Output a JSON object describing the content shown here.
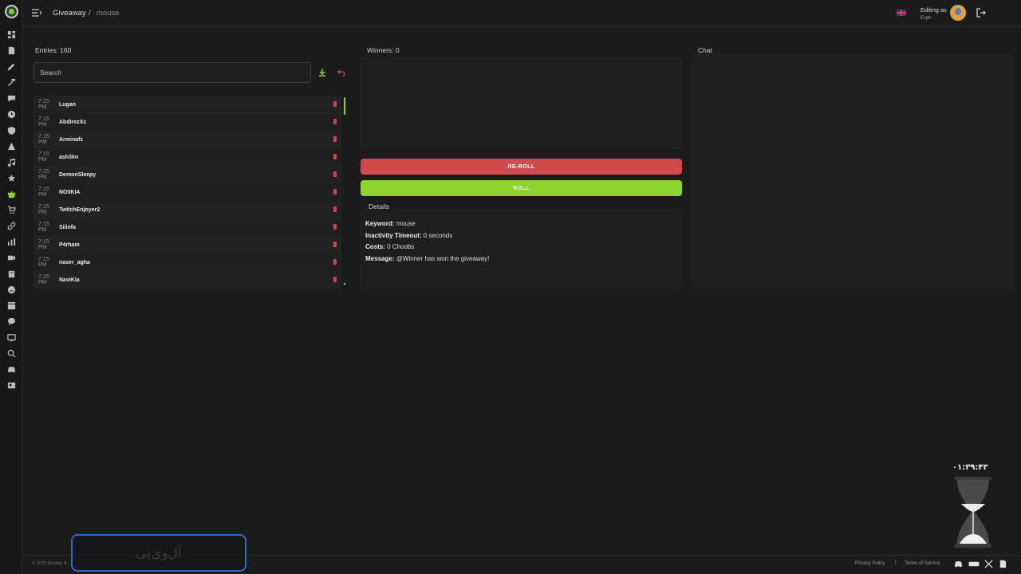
{
  "header": {
    "breadcrumb_section": "Giveaway",
    "breadcrumb_separator": "/",
    "breadcrumb_current": "mouse",
    "editing_label": "Editing as",
    "editing_user": "Erph"
  },
  "entries": {
    "title": "Entries: 160",
    "search_placeholder": "Search",
    "items": [
      {
        "time": "7:15 PM",
        "name": "Lugan"
      },
      {
        "time": "7:15 PM",
        "name": "AbdirezXc"
      },
      {
        "time": "7:15 PM",
        "name": "Arminafz"
      },
      {
        "time": "7:15 PM",
        "name": "ash3kn"
      },
      {
        "time": "7:15 PM",
        "name": "DemonSleepy"
      },
      {
        "time": "7:15 PM",
        "name": "NO0KIA"
      },
      {
        "time": "7:15 PM",
        "name": "TwitchEnjoyer2"
      },
      {
        "time": "7:15 PM",
        "name": "Siiinfa"
      },
      {
        "time": "7:15 PM",
        "name": "P4rham"
      },
      {
        "time": "7:15 PM",
        "name": "naser_agha"
      },
      {
        "time": "7:15 PM",
        "name": "NaviKia"
      }
    ]
  },
  "winners": {
    "title": "Winners: 0"
  },
  "actions": {
    "reroll_label": "RE-ROLL",
    "roll_label": "ROLL"
  },
  "details": {
    "title": "Details",
    "keyword_label": "Keyword:",
    "keyword_value": "mouse",
    "inactivity_label": "Inactivity Timeout:",
    "inactivity_value": "0 seconds",
    "costs_label": "Costs:",
    "costs_value": "0 Choobs",
    "message_label": "Message:",
    "message_value": "@Winner has won the giveaway!"
  },
  "chat": {
    "title": "Chat"
  },
  "footer": {
    "copyright": "© 2025 Kickbot. A",
    "privacy": "Privacy Policy",
    "separator": "|",
    "terms": "Terms of Service"
  },
  "overlay": {
    "timer": "۰۱:۳۹:۴۳",
    "watermark": "آل‌وی‌پی"
  },
  "colors": {
    "accent": "#8fd42e",
    "danger": "#cf4b4b",
    "background": "#1b1b1b"
  }
}
